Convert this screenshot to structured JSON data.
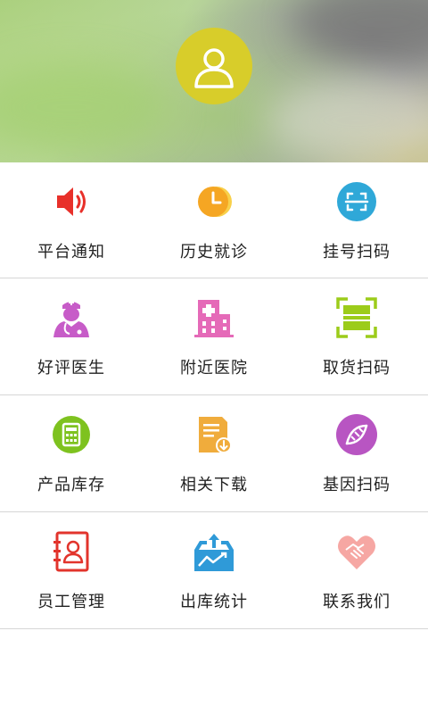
{
  "header": {
    "avatar_icon": "user-avatar-icon",
    "avatar_color": "#d8cd2a"
  },
  "menu": {
    "rows": [
      [
        {
          "label": "平台通知",
          "icon": "speaker-icon",
          "color": "#e8302a"
        },
        {
          "label": "历史就诊",
          "icon": "clock-icon",
          "color": "#f5a623"
        },
        {
          "label": "挂号扫码",
          "icon": "scan-icon",
          "color": "#2fa8d8"
        }
      ],
      [
        {
          "label": "好评医生",
          "icon": "doctor-icon",
          "color": "#c75cc8"
        },
        {
          "label": "附近医院",
          "icon": "hospital-icon",
          "color": "#e56ab8"
        },
        {
          "label": "取货扫码",
          "icon": "scan-frame-icon",
          "color": "#9ccc1a"
        }
      ],
      [
        {
          "label": "产品库存",
          "icon": "calculator-icon",
          "color": "#7ec21f"
        },
        {
          "label": "相关下载",
          "icon": "download-document-icon",
          "color": "#f0ac3c"
        },
        {
          "label": "基因扫码",
          "icon": "dna-icon",
          "color": "#b855c2"
        }
      ],
      [
        {
          "label": "员工管理",
          "icon": "contact-card-icon",
          "color": "#e2342c"
        },
        {
          "label": "出库统计",
          "icon": "statistics-tray-icon",
          "color": "#2f9ad8"
        },
        {
          "label": "联系我们",
          "icon": "handshake-heart-icon",
          "color": "#f6a7a3"
        }
      ]
    ]
  }
}
